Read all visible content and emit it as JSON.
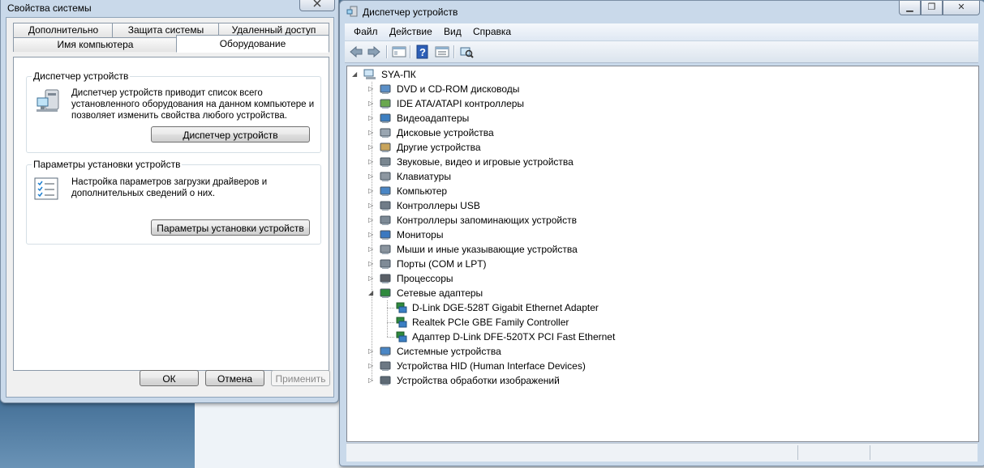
{
  "system_properties": {
    "title": "Свойства системы",
    "tabs_row1": [
      "Дополнительно",
      "Защита системы",
      "Удаленный доступ"
    ],
    "tabs_row2": [
      "Имя компьютера",
      "Оборудование"
    ],
    "active_tab": "Оборудование",
    "device_manager_group": {
      "label": "Диспетчер устройств",
      "text_lines": [
        "Диспетчер устройств приводит список всего",
        "установленного оборудования на данном компьютере и",
        "позволяет изменить свойства любого устройства."
      ],
      "button": "Диспетчер устройств"
    },
    "install_group": {
      "label": "Параметры установки устройств",
      "text_lines": [
        "Настройка параметров загрузки драйверов и",
        "дополнительных сведений о них."
      ],
      "button": "Параметры установки устройств"
    },
    "buttons": {
      "ok": "ОК",
      "cancel": "Отмена",
      "apply": "Применить"
    }
  },
  "device_manager": {
    "title": "Диспетчер устройств",
    "menu": [
      "Файл",
      "Действие",
      "Вид",
      "Справка"
    ],
    "root": "SYA-ПК",
    "categories": [
      {
        "label": "DVD и CD-ROM дисководы",
        "icon": "dvd-icon"
      },
      {
        "label": "IDE ATA/ATAPI контроллеры",
        "icon": "ide-controller-icon"
      },
      {
        "label": "Видеоадаптеры",
        "icon": "display-adapter-icon"
      },
      {
        "label": "Дисковые устройства",
        "icon": "disk-drive-icon"
      },
      {
        "label": "Другие устройства",
        "icon": "other-device-icon"
      },
      {
        "label": "Звуковые, видео и игровые устройства",
        "icon": "sound-icon"
      },
      {
        "label": "Клавиатуры",
        "icon": "keyboard-icon"
      },
      {
        "label": "Компьютер",
        "icon": "computer-icon"
      },
      {
        "label": "Контроллеры USB",
        "icon": "usb-icon"
      },
      {
        "label": "Контроллеры запоминающих устройств",
        "icon": "storage-controller-icon"
      },
      {
        "label": "Мониторы",
        "icon": "monitor-icon"
      },
      {
        "label": "Мыши и иные указывающие устройства",
        "icon": "mouse-icon"
      },
      {
        "label": "Порты (COM и LPT)",
        "icon": "port-icon"
      },
      {
        "label": "Процессоры",
        "icon": "processor-icon"
      },
      {
        "label": "Сетевые адаптеры",
        "icon": "network-adapter-icon",
        "expanded": true
      },
      {
        "label": "Системные устройства",
        "icon": "system-device-icon"
      },
      {
        "label": "Устройства HID (Human Interface Devices)",
        "icon": "hid-icon"
      },
      {
        "label": "Устройства обработки изображений",
        "icon": "imaging-device-icon"
      }
    ],
    "network_adapters": [
      "D-Link DGE-528T Gigabit Ethernet Adapter",
      "Realtek PCIe GBE Family Controller",
      "Адаптер D-Link DFE-520TX PCI Fast Ethernet"
    ]
  }
}
